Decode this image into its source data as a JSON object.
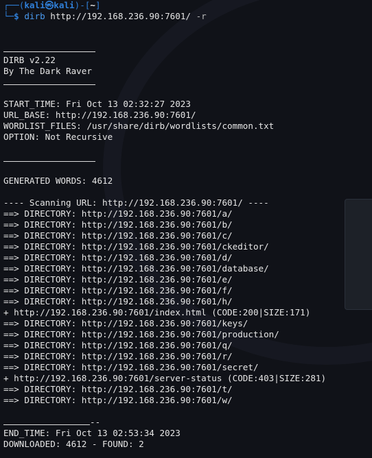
{
  "prompt": {
    "frame_top": "┌──(",
    "user": "kali㉿kali",
    "frame_mid": ")-[",
    "cwd": "~",
    "frame_end": "]",
    "frame_bottom": "└─",
    "dollar": "$ ",
    "command": "dirb",
    "args": " http://192.168.236.90:7601/ ",
    "flag": "-r"
  },
  "banner": {
    "version": "DIRB v2.22",
    "author": "By The Dark Raver"
  },
  "info": {
    "start_time": "START_TIME: Fri Oct 13 02:32:27 2023",
    "url_base": "URL_BASE: http://192.168.236.90:7601/",
    "wordlist": "WORDLIST_FILES: /usr/share/dirb/wordlists/common.txt",
    "option": "OPTION: Not Recursive"
  },
  "generated": "GENERATED WORDS: 4612",
  "scanning": "---- Scanning URL: http://192.168.236.90:7601/ ----",
  "results": [
    "==> DIRECTORY: http://192.168.236.90:7601/a/",
    "==> DIRECTORY: http://192.168.236.90:7601/b/",
    "==> DIRECTORY: http://192.168.236.90:7601/c/",
    "==> DIRECTORY: http://192.168.236.90:7601/ckeditor/",
    "==> DIRECTORY: http://192.168.236.90:7601/d/",
    "==> DIRECTORY: http://192.168.236.90:7601/database/",
    "==> DIRECTORY: http://192.168.236.90:7601/e/",
    "==> DIRECTORY: http://192.168.236.90:7601/f/",
    "==> DIRECTORY: http://192.168.236.90:7601/h/",
    "+ http://192.168.236.90:7601/index.html (CODE:200|SIZE:171)",
    "==> DIRECTORY: http://192.168.236.90:7601/keys/",
    "==> DIRECTORY: http://192.168.236.90:7601/production/",
    "==> DIRECTORY: http://192.168.236.90:7601/q/",
    "==> DIRECTORY: http://192.168.236.90:7601/r/",
    "==> DIRECTORY: http://192.168.236.90:7601/secret/",
    "+ http://192.168.236.90:7601/server-status (CODE:403|SIZE:281)",
    "==> DIRECTORY: http://192.168.236.90:7601/t/",
    "==> DIRECTORY: http://192.168.236.90:7601/w/"
  ],
  "footer": {
    "rule_tail": "--",
    "end_time": "END_TIME: Fri Oct 13 02:53:34 2023",
    "downloaded": "DOWNLOADED: 4612 - FOUND: 2"
  },
  "colors": {
    "background": "#101218",
    "prompt_blue": "#2f7fd8",
    "text": "#e6e6e6"
  }
}
